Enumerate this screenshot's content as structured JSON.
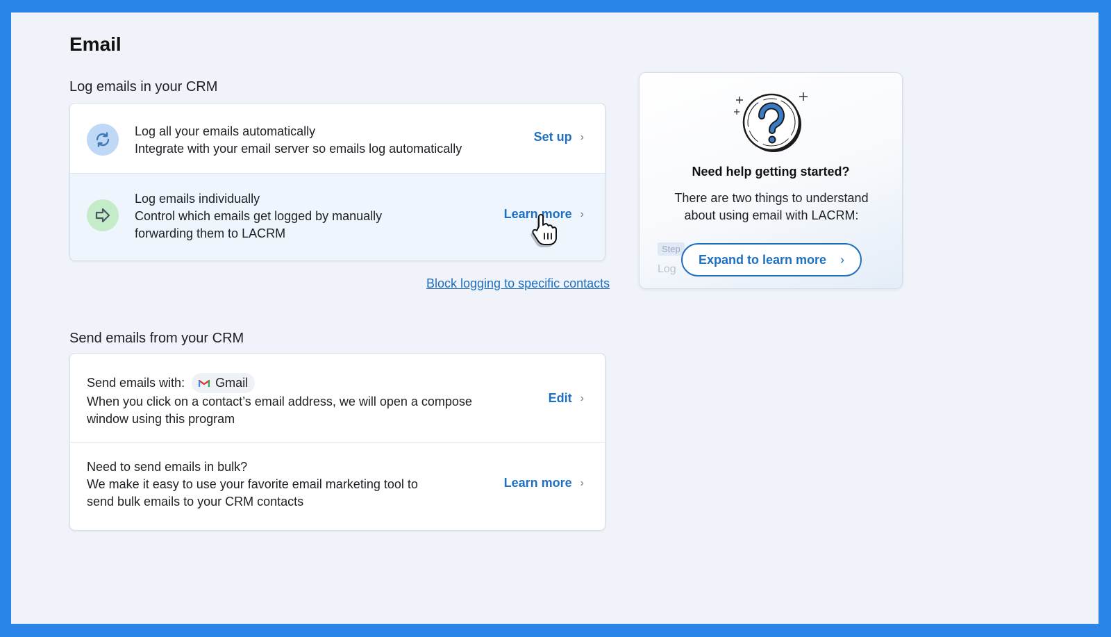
{
  "page": {
    "title": "Email"
  },
  "log_section": {
    "title": "Log emails in your CRM",
    "rows": [
      {
        "icon": "sync-icon",
        "title": "Log all your emails automatically",
        "desc": "Integrate with your email server so emails log automatically",
        "action": "Set up"
      },
      {
        "icon": "arrow-right-icon",
        "title": "Log emails individually",
        "desc1": "Control which emails get logged by manually",
        "desc2": "forwarding them to LACRM",
        "action": "Learn more"
      }
    ],
    "block_link": "Block logging to specific contacts"
  },
  "send_section": {
    "title": "Send emails from your CRM",
    "rows": [
      {
        "label": "Send emails with:",
        "provider": "Gmail",
        "desc1": "When you click on a contact’s email address, we will open a compose",
        "desc2": "window using this program",
        "action": "Edit"
      },
      {
        "title": "Need to send emails in bulk?",
        "desc1": "We make it easy to use your favorite email marketing tool to",
        "desc2": "send bulk emails to your CRM contacts",
        "action": "Learn more"
      }
    ]
  },
  "help_card": {
    "icon": "question-mark-icon",
    "title": "Need help getting started?",
    "body1": "There are two things to understand",
    "body2": "about using email with LACRM:",
    "faded_step": "Step",
    "faded_log": "Log",
    "button": "Expand to learn more"
  },
  "colors": {
    "frame": "#2b85e8",
    "background": "#f0f4fa",
    "link": "#1f6fbf"
  }
}
